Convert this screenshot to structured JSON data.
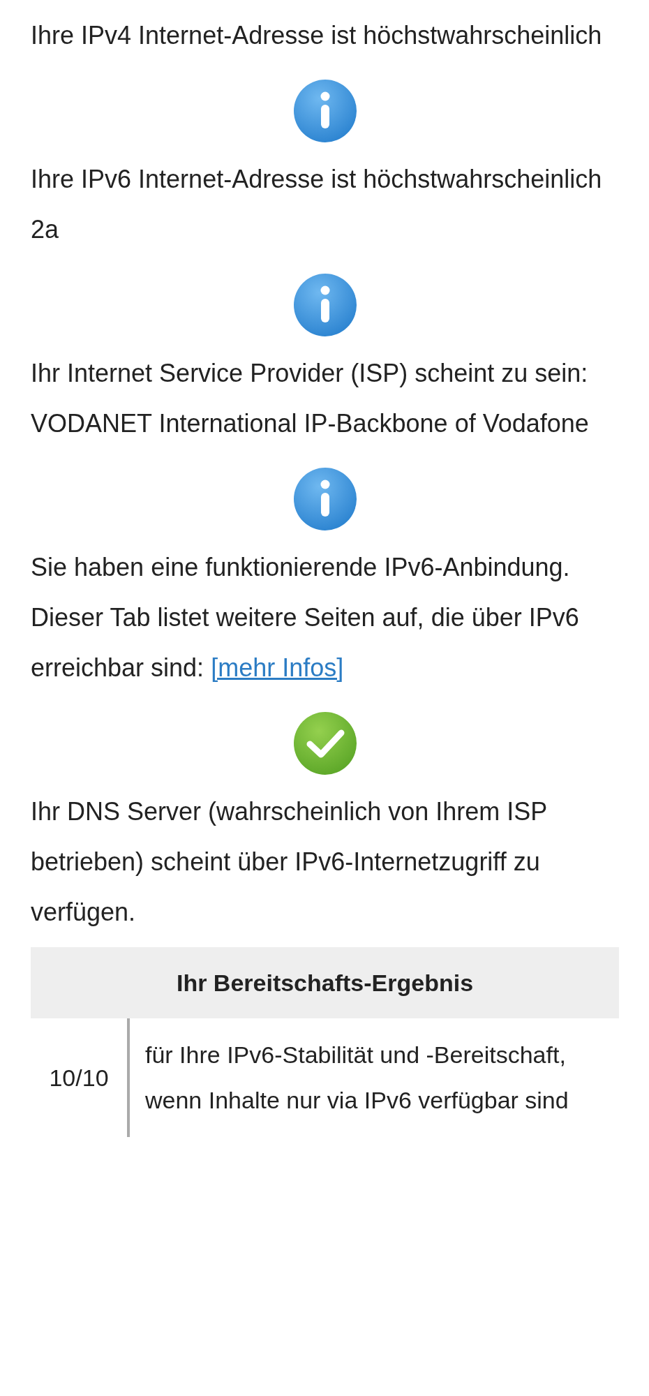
{
  "results": [
    {
      "kind": "text",
      "text": "Ihre IPv4 Internet-Adresse ist höchstwahrscheinlich"
    },
    {
      "kind": "info"
    },
    {
      "kind": "text",
      "text": "Ihre IPv6 Internet-Adresse ist höchstwahrscheinlich",
      "address": "2a"
    },
    {
      "kind": "info"
    },
    {
      "kind": "text",
      "text": "Ihr Internet Service Provider (ISP) scheint zu sein: VODANET International IP-Backbone of Vodafone"
    },
    {
      "kind": "info"
    },
    {
      "kind": "text",
      "text": "Sie haben eine funktionierende IPv6-Anbindung. Dieser Tab listet weitere Seiten auf, die über IPv6 erreichbar sind:",
      "link": "[mehr Infos]"
    },
    {
      "kind": "check"
    },
    {
      "kind": "text",
      "text": "Ihr DNS Server (wahrscheinlich von Ihrem ISP betrieben) scheint über IPv6-Internetzugriff zu verfügen."
    }
  ],
  "score_table": {
    "title": "Ihr Bereitschafts-Ergebnis",
    "rows": [
      {
        "score": "10/10",
        "description": "für Ihre IPv6-Stabilität und -Bereitschaft, wenn Inhalte nur via IPv6 verfügbar sind"
      }
    ]
  }
}
